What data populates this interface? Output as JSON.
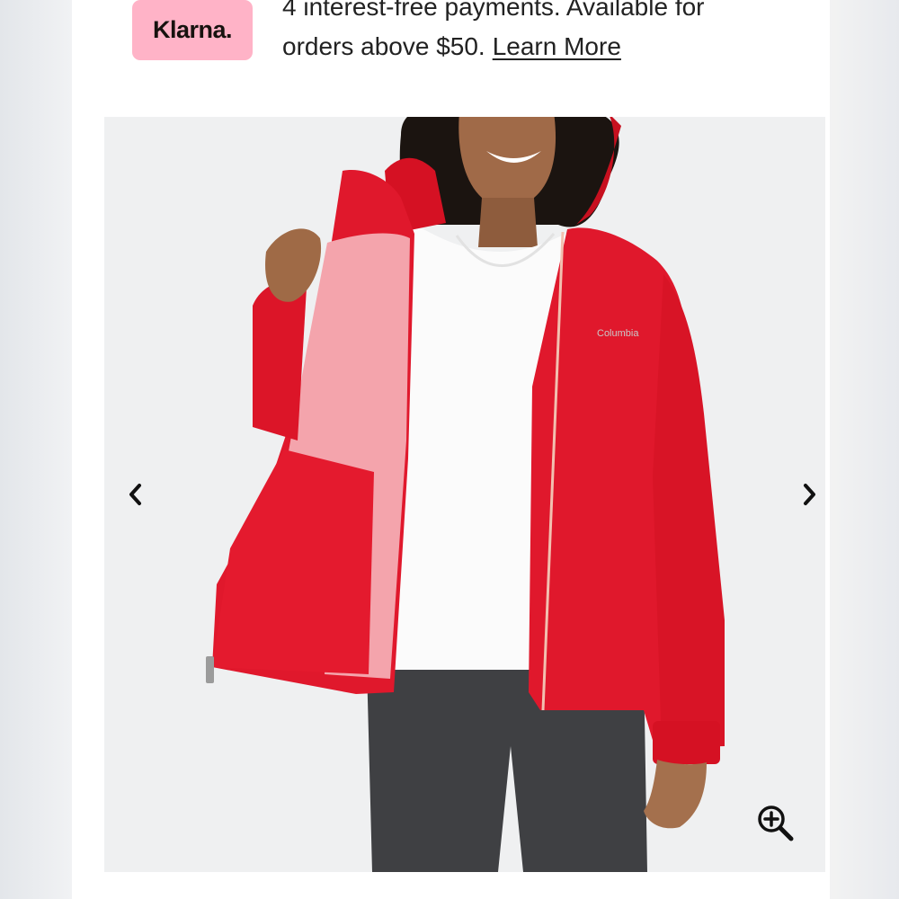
{
  "klarna": {
    "logo_text": "Klarna.",
    "line1": "4 interest-free payments. Available for",
    "line2": "orders above $50.",
    "learn_more": "Learn More",
    "badge_color": "#ffb3c7"
  },
  "product_image": {
    "logo_text": "Columbia",
    "jacket_color": "#e0182c",
    "icons": {
      "prev": "chevron-left-icon",
      "next": "chevron-right-icon",
      "zoom": "zoom-in-icon"
    }
  }
}
